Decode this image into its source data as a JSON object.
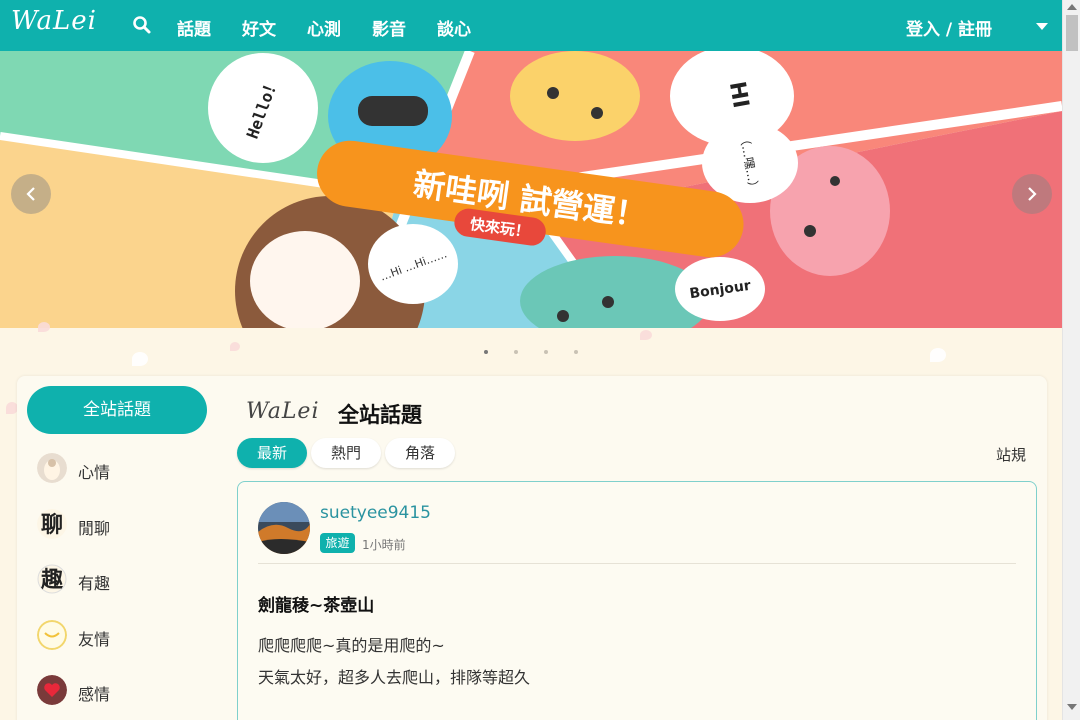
{
  "nav": {
    "logo": "WaLei",
    "items": [
      "話題",
      "好文",
      "心測",
      "影音",
      "談心"
    ],
    "login": "登入 / 註冊"
  },
  "banner": {
    "headline": "新哇咧 試營運！",
    "badge": "快來玩！",
    "bubbles": [
      "Hello！",
      "HI",
      "（…嘿…）",
      "…Hi …Hi……",
      "Bonjour"
    ],
    "slide_count": 4,
    "active_slide": 1
  },
  "sidebar": {
    "all_label": "全站話題",
    "items": [
      {
        "label": "心情",
        "icon": "mood-avatar"
      },
      {
        "label": "閒聊",
        "icon": "chat-avatar"
      },
      {
        "label": "有趣",
        "icon": "fun-avatar"
      },
      {
        "label": "友情",
        "icon": "friendship-avatar"
      },
      {
        "label": "感情",
        "icon": "love-avatar"
      }
    ]
  },
  "section": {
    "logo": "WaLei",
    "title": "全站話題",
    "tabs": [
      "最新",
      "熱門",
      "角落"
    ],
    "active_tab": "最新",
    "rules": "站規"
  },
  "post": {
    "username": "suetyee9415",
    "tag": "旅遊",
    "time": "1小時前",
    "title": "劍龍稜~茶壺山",
    "lines": [
      "爬爬爬爬~真的是用爬的~",
      "天氣太好，超多人去爬山，排隊等超久"
    ]
  },
  "colors": {
    "brand": "#0fb1ad",
    "page_bg": "#fdf6e6",
    "banner_orange": "#f7941d"
  }
}
